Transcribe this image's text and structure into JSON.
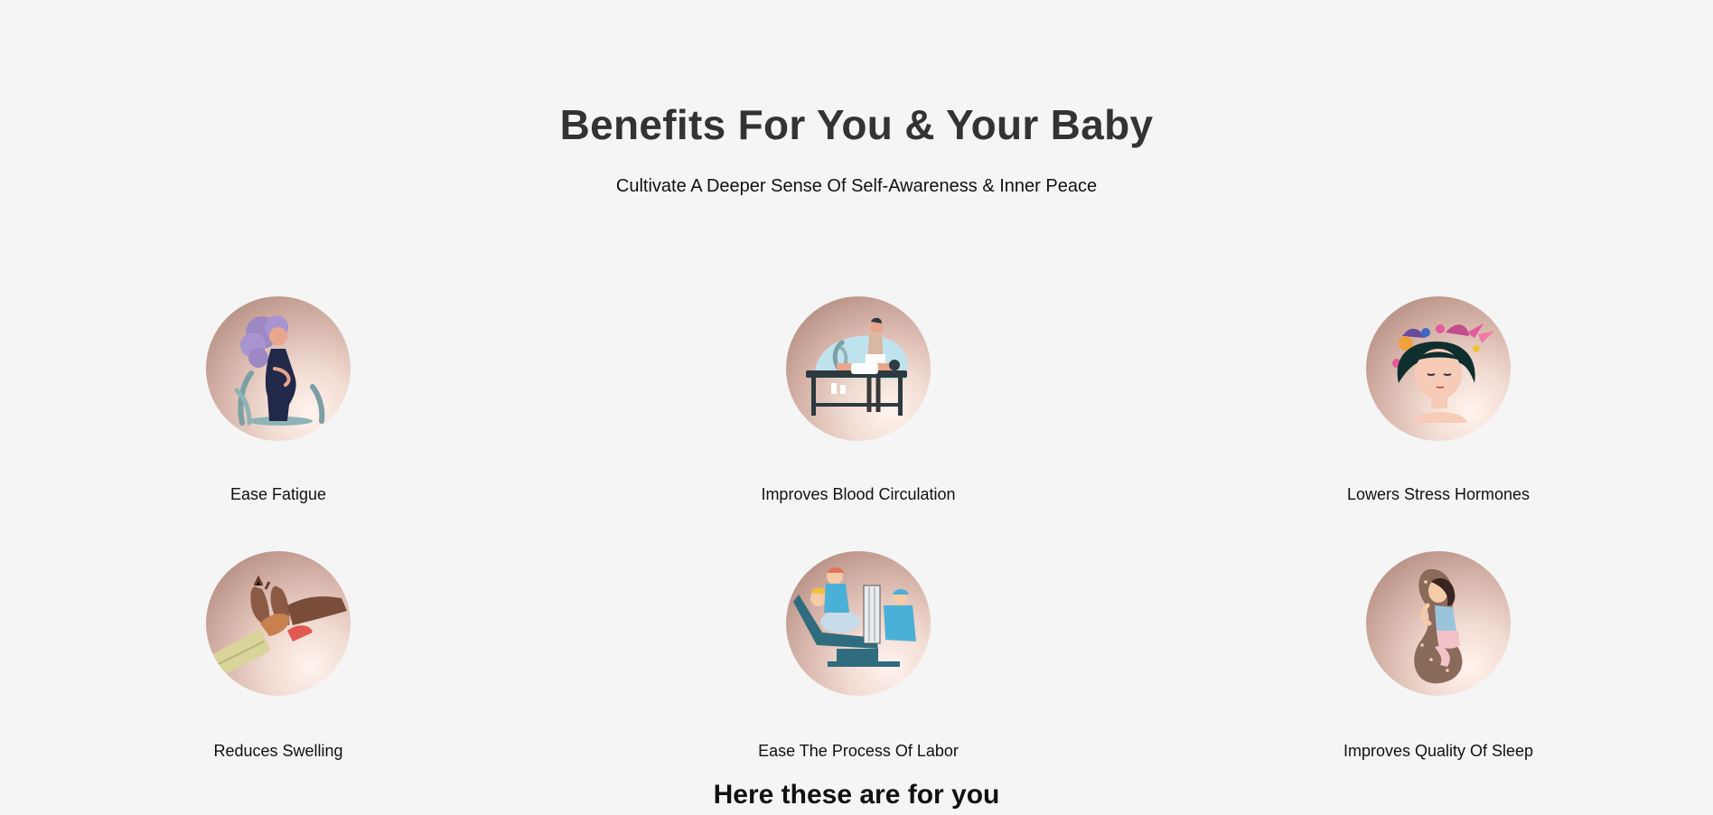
{
  "section": {
    "title": "Benefits For You & Your Baby",
    "subtitle": "Cultivate A Deeper Sense Of Self-Awareness & Inner Peace"
  },
  "benefits": [
    {
      "label": "Ease Fatigue",
      "icon": "pregnant-woman-illustration"
    },
    {
      "label": "Improves Blood Circulation",
      "icon": "massage-table-illustration"
    },
    {
      "label": "Lowers Stress Hormones",
      "icon": "calm-woman-flowers-illustration"
    },
    {
      "label": "Reduces Swelling",
      "icon": "foot-massage-illustration"
    },
    {
      "label": "Ease The Process Of Labor",
      "icon": "delivery-room-illustration"
    },
    {
      "label": "Improves Quality Of Sleep",
      "icon": "sleeping-pillow-illustration"
    }
  ],
  "footer": {
    "heading": "Here these are for you"
  }
}
